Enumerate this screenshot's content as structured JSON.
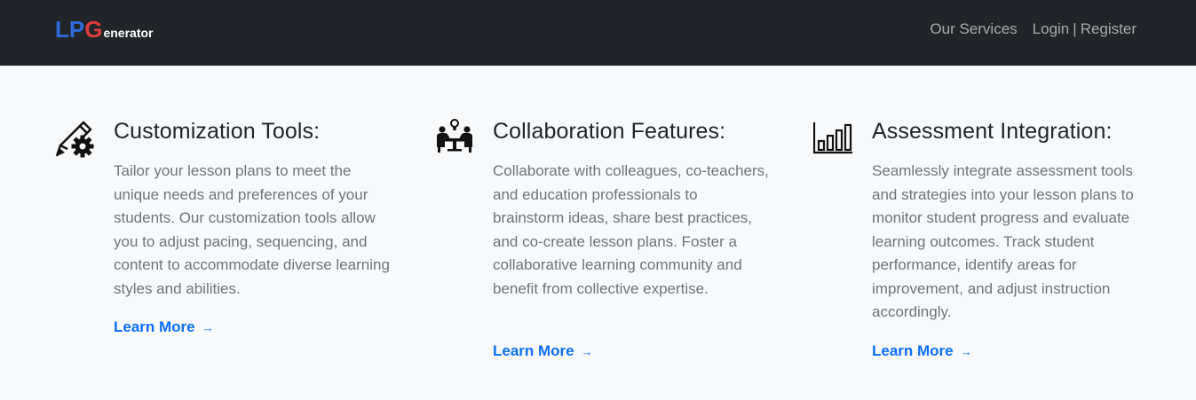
{
  "navbar": {
    "logo": {
      "part1": "LP",
      "part2": "G",
      "part3": "enerator"
    },
    "links": {
      "services": "Our Services",
      "login": "Login",
      "separator": "|",
      "register": "Register"
    }
  },
  "features": [
    {
      "icon": "edit-gear-icon",
      "title": "Customization Tools:",
      "description": "Tailor your lesson plans to meet the unique needs and preferences of your students. Our customization tools allow you to adjust pacing, sequencing, and content to accommodate diverse learning styles and abilities.",
      "link_label": "Learn More",
      "link_arrow": "→"
    },
    {
      "icon": "team-meeting-icon",
      "title": "Collaboration Features:",
      "description": "Collaborate with colleagues, co-teachers, and education professionals to brainstorm ideas, share best practices, and co-create lesson plans. Foster a collaborative learning community and benefit from collective expertise.",
      "link_label": "Learn More",
      "link_arrow": "→"
    },
    {
      "icon": "bar-chart-icon",
      "title": "Assessment Integration:",
      "description": "Seamlessly integrate assessment tools and strategies into your lesson plans to monitor student progress and evaluate learning outcomes. Track student performance, identify areas for improvement, and adjust instruction accordingly.",
      "link_label": "Learn More",
      "link_arrow": "→"
    }
  ],
  "colors": {
    "navbar_bg": "#212529",
    "accent": "#0d6efd",
    "logo_blue": "#2d6bdb",
    "logo_red": "#e03c3c",
    "body_bg": "#f8f9fa"
  }
}
